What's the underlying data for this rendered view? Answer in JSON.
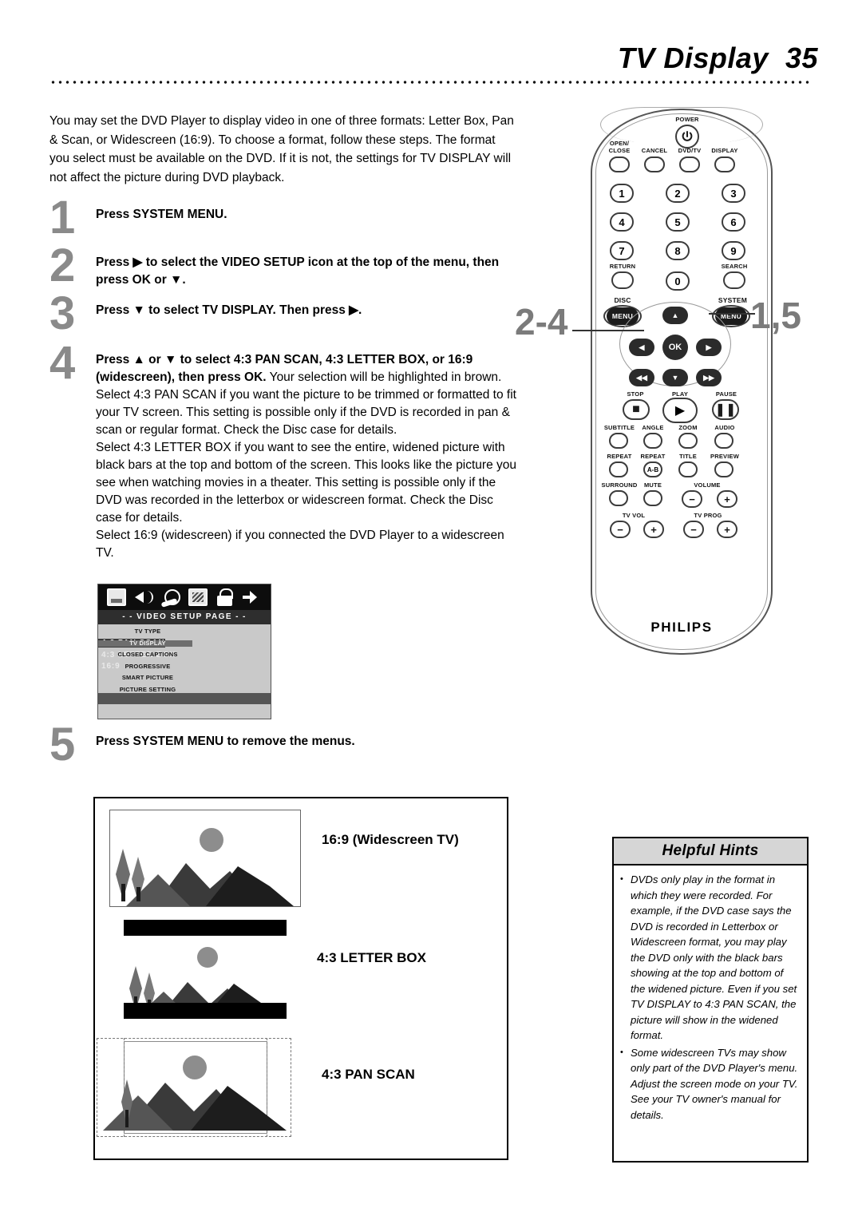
{
  "header": {
    "title": "TV Display  35"
  },
  "intro": {
    "text": "You may set the DVD Player to display video in one of three formats: Letter Box, Pan & Scan, or Widescreen (16:9). To choose a format, follow these steps. The format you select must be available on the DVD. If it is not, the settings for TV DISPLAY will not affect the picture during DVD playback."
  },
  "steps": [
    {
      "num": "1",
      "bold": "Press SYSTEM MENU.",
      "rest": ""
    },
    {
      "num": "2",
      "bold": "Press ▶ to select the VIDEO SETUP icon at the top of the menu, then press OK or ▼.",
      "rest": ""
    },
    {
      "num": "3",
      "bold": "Press ▼ to select TV DISPLAY. Then press ▶.",
      "rest": ""
    },
    {
      "num": "4",
      "bold": "Press ▲ or ▼ to select 4:3 PAN SCAN, 4:3 LETTER BOX, or 16:9 (widescreen), then press OK.",
      "rest": " Your selection will be highlighted in brown.",
      "paras": [
        "Select 4:3 PAN SCAN if you want the picture to be trimmed or formatted to fit your TV screen. This setting is possible only if the DVD is recorded in pan & scan or regular format. Check the Disc case for details.",
        "Select 4:3 LETTER BOX if you want to see the entire, widened picture with black bars at the top and bottom of the screen. This looks like the picture you see when watching movies in a theater. This setting is possible only if the DVD was recorded in the letterbox or widescreen format. Check the Disc case for details.",
        "Select 16:9 (widescreen) if you connected the DVD Player to a widescreen TV."
      ]
    },
    {
      "num": "5",
      "bold": "Press SYSTEM MENU to remove the menus.",
      "rest": ""
    }
  ],
  "osd": {
    "title": "- -  VIDEO  SETUP  PAGE  - -",
    "icons": [
      "monitor-icon",
      "speaker-icon",
      "disc-icon",
      "preference-icon",
      "lock-icon",
      "exit-icon"
    ],
    "rows": [
      {
        "label": "TV TYPE",
        "value": "",
        "selected": false
      },
      {
        "label": "TV DISPLAY",
        "value": "4:3  PAN  SCAN",
        "selected": true
      },
      {
        "label": "CLOSED CAPTIONS",
        "value": "4:3 LETTER BOX",
        "selected": false
      },
      {
        "label": "PROGRESSIVE",
        "value": "16:9",
        "selected": false
      },
      {
        "label": "SMART PICTURE",
        "value": "",
        "selected": false
      },
      {
        "label": "PICTURE SETTING",
        "value": "",
        "selected": false
      }
    ]
  },
  "illustrations": [
    {
      "label": "16:9 (Widescreen TV)",
      "mode": "widescreen"
    },
    {
      "label": "4:3 LETTER BOX",
      "mode": "letterbox"
    },
    {
      "label": "4:3 PAN SCAN",
      "mode": "panscan"
    }
  ],
  "remote": {
    "brand": "PHILIPS",
    "power_label": "POWER",
    "power_glyph": "⏻",
    "top_buttons": [
      "OPEN/\nCLOSE",
      "CANCEL",
      "DVD/TV",
      "DISPLAY"
    ],
    "numbers": [
      "1",
      "2",
      "3",
      "4",
      "5",
      "6",
      "7",
      "8",
      "9",
      "0"
    ],
    "return_label": "RETURN",
    "search_label": "SEARCH",
    "disc_label": "DISC",
    "system_label": "SYSTEM",
    "menu_label": "MENU",
    "ok_label": "OK",
    "transport_labels": [
      "STOP",
      "PLAY",
      "PAUSE"
    ],
    "feature_row1": [
      "SUBTITLE",
      "ANGLE",
      "ZOOM",
      "AUDIO"
    ],
    "feature_row2": [
      "REPEAT",
      "REPEAT",
      "TITLE",
      "PREVIEW"
    ],
    "repeat_ab": "A-B",
    "feature_row3": [
      "SURROUND",
      "MUTE",
      "VOLUME"
    ],
    "tv_vol_label": "TV VOL",
    "tv_prog_label": "TV PROG",
    "minus": "−",
    "plus": "+",
    "callout_left": "2-4",
    "callout_right": "1,5"
  },
  "hints": {
    "title": "Helpful Hints",
    "bullet": "•",
    "items": [
      "DVDs only play in the format in which they were recorded. For example, if the DVD case says the DVD is recorded in Letterbox or Widescreen format, you may play the DVD only with the black bars showing at the top and bottom of the widened picture. Even if you set TV DISPLAY to 4:3 PAN SCAN, the picture will show in the widened format.",
      "Some widescreen TVs may show only part of the DVD Player's menu. Adjust the screen mode on your TV. See your TV owner's manual for details."
    ]
  }
}
